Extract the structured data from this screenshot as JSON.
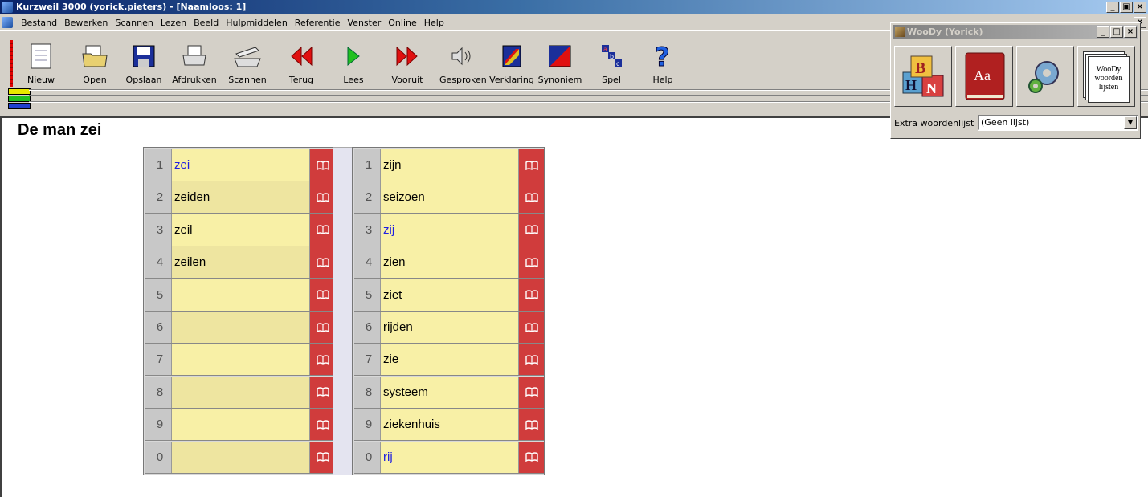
{
  "titlebar": {
    "title": "Kurzweil 3000 (yorick.pieters) - [Naamloos: 1]"
  },
  "menu": [
    "Bestand",
    "Bewerken",
    "Scannen",
    "Lezen",
    "Beeld",
    "Hulpmiddelen",
    "Referentie",
    "Venster",
    "Online",
    "Help"
  ],
  "toolbar": {
    "buttons": [
      {
        "label": "Nieuw",
        "icon": "new-document-icon"
      },
      {
        "label": "Open",
        "icon": "open-folder-icon"
      },
      {
        "label": "Opslaan",
        "icon": "save-disk-icon"
      },
      {
        "label": "Afdrukken",
        "icon": "printer-icon"
      },
      {
        "label": "Scannen",
        "icon": "scanner-icon"
      },
      {
        "label": "Terug",
        "icon": "rewind-icon"
      },
      {
        "label": "Lees",
        "icon": "play-icon"
      },
      {
        "label": "Vooruit",
        "icon": "fast-forward-icon"
      },
      {
        "label": "Gesproken",
        "icon": "speaker-icon"
      },
      {
        "label": "Verklaring",
        "icon": "definition-icon"
      },
      {
        "label": "Synoniem",
        "icon": "synonym-icon"
      },
      {
        "label": "Spel",
        "icon": "spell-icon"
      },
      {
        "label": "Help",
        "icon": "help-icon"
      }
    ]
  },
  "document": {
    "text": "De man zei"
  },
  "prediction_left": {
    "rows": [
      {
        "num": "1",
        "word": "zei",
        "highlight": true
      },
      {
        "num": "2",
        "word": "zeiden",
        "highlight": false
      },
      {
        "num": "3",
        "word": "zeil",
        "highlight": false
      },
      {
        "num": "4",
        "word": "zeilen",
        "highlight": false
      },
      {
        "num": "5",
        "word": "",
        "highlight": false
      },
      {
        "num": "6",
        "word": "",
        "highlight": false
      },
      {
        "num": "7",
        "word": "",
        "highlight": false
      },
      {
        "num": "8",
        "word": "",
        "highlight": false
      },
      {
        "num": "9",
        "word": "",
        "highlight": false
      },
      {
        "num": "0",
        "word": "",
        "highlight": false
      }
    ]
  },
  "prediction_right": {
    "rows": [
      {
        "num": "1",
        "word": "zijn",
        "highlight": false
      },
      {
        "num": "2",
        "word": "seizoen",
        "highlight": false
      },
      {
        "num": "3",
        "word": "zij",
        "highlight": true
      },
      {
        "num": "4",
        "word": "zien",
        "highlight": false
      },
      {
        "num": "5",
        "word": "ziet",
        "highlight": false
      },
      {
        "num": "6",
        "word": "rijden",
        "highlight": false
      },
      {
        "num": "7",
        "word": "zie",
        "highlight": false
      },
      {
        "num": "8",
        "word": "systeem",
        "highlight": false
      },
      {
        "num": "9",
        "word": "ziekenhuis",
        "highlight": false
      },
      {
        "num": "0",
        "word": "rij",
        "highlight": true
      }
    ]
  },
  "woody": {
    "title": "WooDy (Yorick)",
    "buttons": [
      {
        "icon": "abc-blocks-icon"
      },
      {
        "icon": "dictionary-book-icon",
        "text": "Aa"
      },
      {
        "icon": "settings-gear-icon"
      },
      {
        "icon": "word-lists-icon",
        "text": [
          "WooDy",
          "woorden",
          "lijsten"
        ]
      }
    ],
    "list_label": "Extra woordenlijst",
    "list_value": "(Geen lijst)"
  },
  "colors": {
    "highlight_text": "#2020e0",
    "word_cell": "#f8f0a6",
    "book_cell": "#d03c3c",
    "title_active": "#0a246a"
  }
}
